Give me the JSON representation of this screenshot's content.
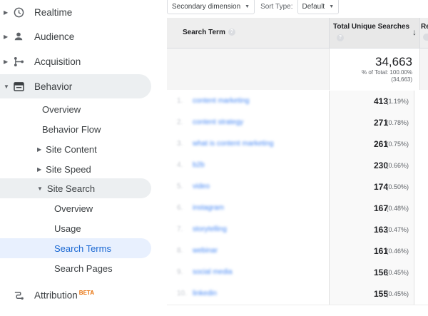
{
  "sidebar": {
    "items": [
      {
        "label": "Realtime",
        "icon": "clock-icon"
      },
      {
        "label": "Audience",
        "icon": "person-icon"
      },
      {
        "label": "Acquisition",
        "icon": "acquisition-icon"
      },
      {
        "label": "Behavior",
        "icon": "behavior-icon"
      }
    ],
    "behavior_sub": {
      "overview": "Overview",
      "behavior_flow": "Behavior Flow",
      "site_content": "Site Content",
      "site_speed": "Site Speed",
      "site_search": "Site Search"
    },
    "site_search_sub": {
      "overview": "Overview",
      "usage": "Usage",
      "search_terms": "Search Terms",
      "search_pages": "Search Pages"
    },
    "attribution": {
      "label": "Attribution",
      "badge": "BETA"
    }
  },
  "toolbar": {
    "secondary_dimension": "Secondary dimension",
    "sort_type_label": "Sort Type:",
    "sort_type_value": "Default"
  },
  "table": {
    "headers": {
      "search_term": "Search Term",
      "total_unique_searches": "Total Unique Searches",
      "next_col": "Re"
    },
    "summary": {
      "value": "34,663",
      "pct_label": "% of Total: 100.00%",
      "total": "(34,663)"
    },
    "rows": [
      {
        "index": "1.",
        "term": "content marketing",
        "value": "413",
        "pct": "(1.19%)"
      },
      {
        "index": "2.",
        "term": "content strategy",
        "value": "271",
        "pct": "(0.78%)"
      },
      {
        "index": "3.",
        "term": "what is content marketing",
        "value": "261",
        "pct": "(0.75%)"
      },
      {
        "index": "4.",
        "term": "b2b",
        "value": "230",
        "pct": "(0.66%)"
      },
      {
        "index": "5.",
        "term": "video",
        "value": "174",
        "pct": "(0.50%)"
      },
      {
        "index": "6.",
        "term": "instagram",
        "value": "167",
        "pct": "(0.48%)"
      },
      {
        "index": "7.",
        "term": "storytelling",
        "value": "163",
        "pct": "(0.47%)"
      },
      {
        "index": "8.",
        "term": "webinar",
        "value": "161",
        "pct": "(0.46%)"
      },
      {
        "index": "9.",
        "term": "social media",
        "value": "156",
        "pct": "(0.45%)"
      },
      {
        "index": "10.",
        "term": "linkedin",
        "value": "155",
        "pct": "(0.45%)"
      }
    ]
  },
  "colors": {
    "selected_text": "#1967d2",
    "selected_bg": "#e8f0fe",
    "highlight_bg": "#eceff1",
    "beta": "#e8710a"
  }
}
